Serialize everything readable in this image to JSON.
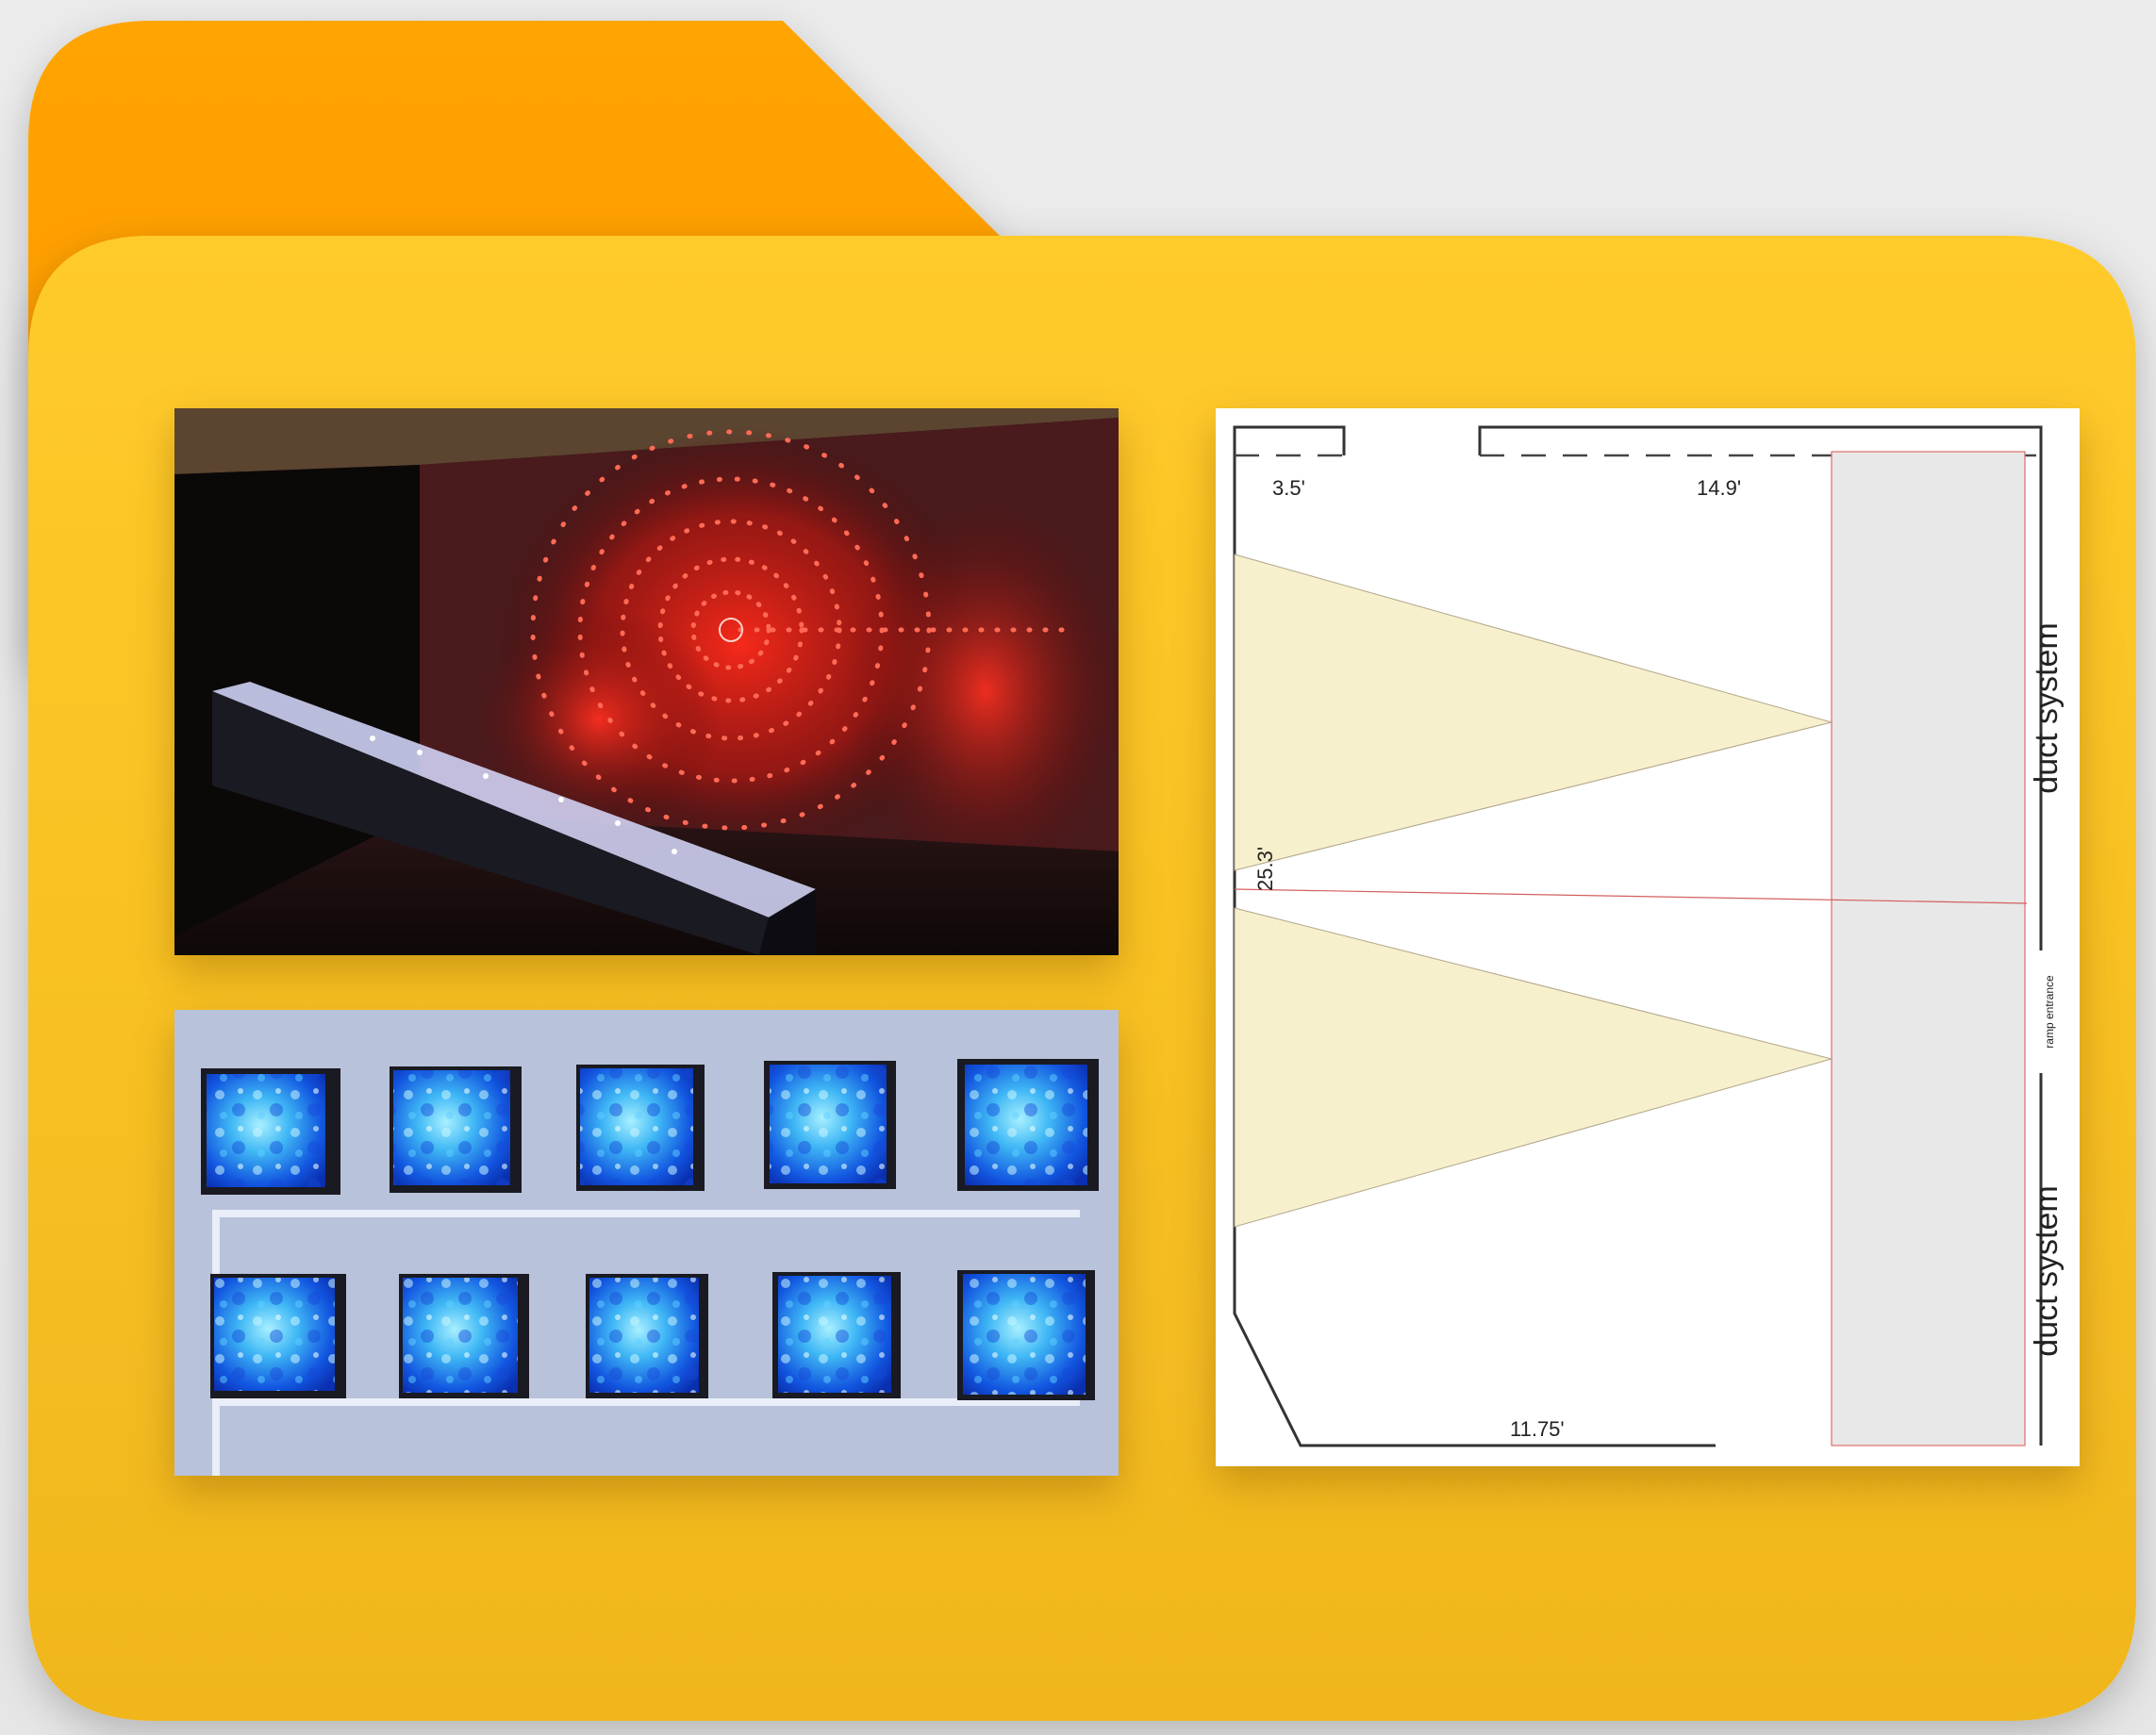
{
  "folder": {
    "tab_color": "#ff9f00",
    "body_color": "#fbc424"
  },
  "plan": {
    "dim_top_left": "3.5'",
    "dim_top_right": "14.9'",
    "dim_vertical": "25.3'",
    "dim_bottom": "11.75'",
    "label_duct_upper": "duct system",
    "label_duct_lower": "duct system",
    "label_ramp": "ramp entrance"
  }
}
